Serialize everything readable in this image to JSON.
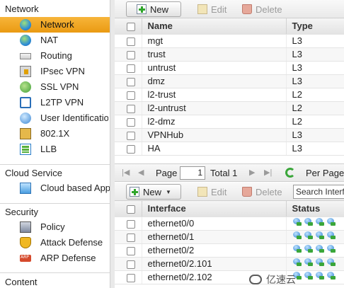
{
  "sidebar": {
    "sections": [
      {
        "title": "Network",
        "items": [
          {
            "label": "Network",
            "icon": "globe-icon",
            "active": true
          },
          {
            "label": "NAT",
            "icon": "globe-arrows-icon"
          },
          {
            "label": "Routing",
            "icon": "router-icon"
          },
          {
            "label": "IPsec VPN",
            "icon": "vpn-tunnel-icon"
          },
          {
            "label": "SSL VPN",
            "icon": "ssl-lock-icon"
          },
          {
            "label": "L2TP VPN",
            "icon": "l2tp-icon"
          },
          {
            "label": "User Identification",
            "icon": "user-globe-icon"
          },
          {
            "label": "802.1X",
            "icon": "dot1x-icon"
          },
          {
            "label": "LLB",
            "icon": "llb-icon"
          }
        ]
      },
      {
        "title": "Cloud Service",
        "items": [
          {
            "label": "Cloud based App",
            "icon": "cloud-app-icon"
          }
        ]
      },
      {
        "title": "Security",
        "items": [
          {
            "label": "Policy",
            "icon": "policy-icon"
          },
          {
            "label": "Attack Defense",
            "icon": "shield-icon"
          },
          {
            "label": "ARP Defense",
            "icon": "arp-icon"
          }
        ]
      },
      {
        "title": "Content",
        "items": []
      }
    ],
    "active_color": "#f0a21b"
  },
  "zones_toolbar": {
    "new_label": "New",
    "edit_label": "Edit",
    "delete_label": "Delete"
  },
  "zones_table": {
    "columns": [
      "Name",
      "Type"
    ],
    "rows": [
      {
        "name": "mgt",
        "type": "L3"
      },
      {
        "name": "trust",
        "type": "L3"
      },
      {
        "name": "untrust",
        "type": "L3"
      },
      {
        "name": "dmz",
        "type": "L3"
      },
      {
        "name": "l2-trust",
        "type": "L2"
      },
      {
        "name": "l2-untrust",
        "type": "L2"
      },
      {
        "name": "l2-dmz",
        "type": "L2"
      },
      {
        "name": "VPNHub",
        "type": "L3"
      },
      {
        "name": "HA",
        "type": "L3"
      }
    ]
  },
  "pager": {
    "page_label": "Page",
    "page_value": "1",
    "total_label": "Total 1",
    "per_page_label": "Per Page"
  },
  "iface_toolbar": {
    "new_label": "New",
    "edit_label": "Edit",
    "delete_label": "Delete",
    "search_placeholder": "Search Interface"
  },
  "iface_table": {
    "columns": [
      "Interface",
      "Status"
    ],
    "rows": [
      {
        "name": "ethernet0/0"
      },
      {
        "name": "ethernet0/1"
      },
      {
        "name": "ethernet0/2"
      },
      {
        "name": "ethernet0/2.101"
      },
      {
        "name": "ethernet0/2.102"
      }
    ]
  },
  "watermark": {
    "text": "亿速云"
  }
}
